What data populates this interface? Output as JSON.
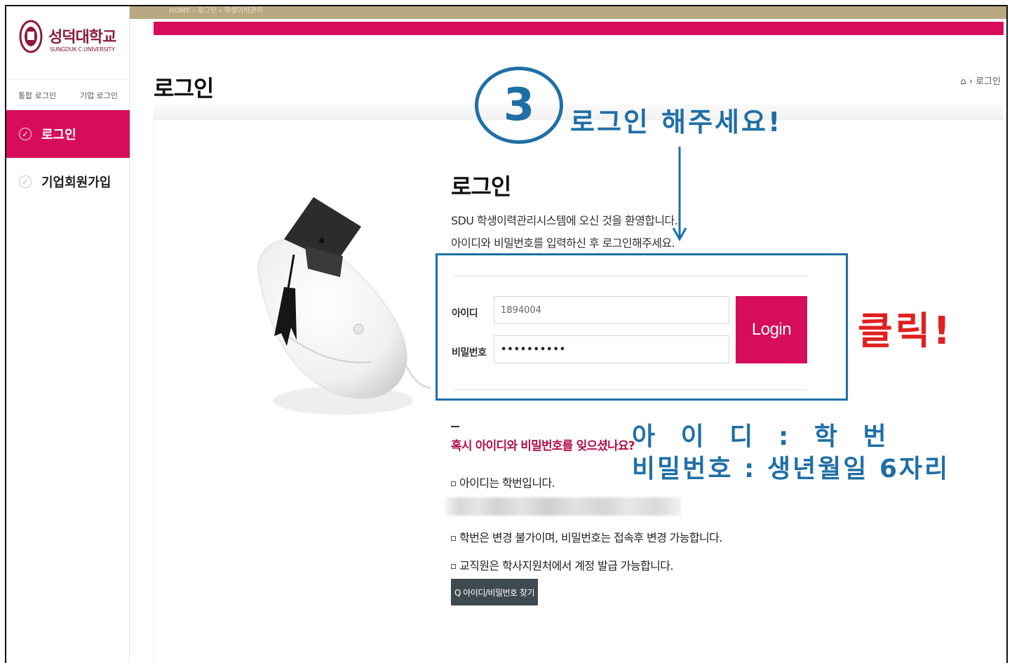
{
  "logo": {
    "name_ko": "성덕대학교",
    "name_en": "SUNGDUK C.UNIVERSITY"
  },
  "login_tabs": [
    "통합 로그인",
    "기업 로그인"
  ],
  "side_menu": [
    {
      "label": "로그인",
      "active": true
    },
    {
      "label": "기업회원가입",
      "active": false
    }
  ],
  "header": {
    "breadcrumb_top": "HOME › 로그인 › 학생이력관리",
    "page_title": "로그인",
    "location": "⌂ › 로그인"
  },
  "login": {
    "heading": "로그인",
    "welcome_line1": "SDU 학생이력관리시스템에 오신 것을 환영합니다.",
    "welcome_line2": "아이디와 비밀번호를 입력하신 후 로그인해주세요.",
    "id_label": "아이디",
    "id_value": "1894004",
    "pw_label": "비밀번호",
    "pw_value": "••••••••••",
    "login_button": "Login"
  },
  "forgot": {
    "question": "혹시 아이디와 비밀번호를 잊으셨나요?",
    "info1": "아이디는 학번입니다.",
    "info2": "학번은 변경 불가이며, 비밀번호는 접속후 변경 가능합니다.",
    "info3": "교직원은 학사지원처에서 계정 발급 가능합니다.",
    "find_button": "Q 아이디/비밀번호 찾기"
  },
  "annotations": {
    "step_number": "3",
    "please_login": "로그인 해주세요!",
    "click": "클릭!",
    "id_hint": "아 이 디 : 학 번",
    "pw_hint": "비밀번호 : 생년월일 6자리"
  },
  "colors": {
    "brand_pink": "#d70c5a",
    "annotation_blue": "#1f6fa6",
    "annotation_red": "#e02020",
    "topbar_olive": "#b8a982",
    "find_button_bg": "#3d4a50"
  }
}
